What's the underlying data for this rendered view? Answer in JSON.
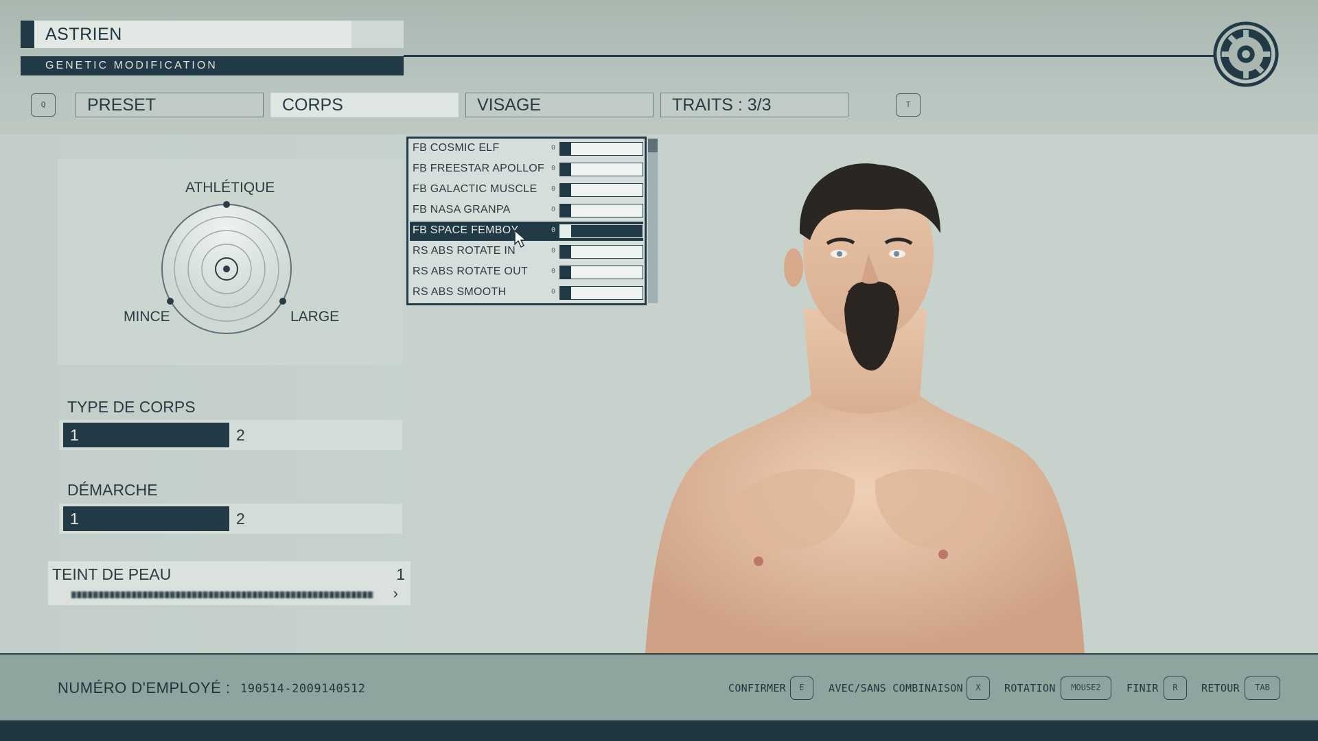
{
  "header": {
    "character_name": "ASTRIEN",
    "subtitle": "GENETIC MODIFICATION",
    "logo_icon": "constellation-gear-icon"
  },
  "tabs": {
    "prev_key": "Q",
    "next_key": "T",
    "items": [
      {
        "label": "PRESET",
        "active": false
      },
      {
        "label": "CORPS",
        "active": true
      },
      {
        "label": "VISAGE",
        "active": false
      },
      {
        "label": "TRAITS : 3/3",
        "active": false
      }
    ]
  },
  "body_shape": {
    "top_label": "ATHLÉTIQUE",
    "left_label": "MINCE",
    "right_label": "LARGE"
  },
  "body_type": {
    "label": "TYPE DE CORPS",
    "options": [
      "1",
      "2"
    ],
    "selected": "1"
  },
  "gait": {
    "label": "DÉMARCHE",
    "options": [
      "1",
      "2"
    ],
    "selected": "1"
  },
  "skin_tone": {
    "label": "TEINT DE PEAU",
    "value": "1"
  },
  "morphs": {
    "items": [
      {
        "name": "FB COSMIC ELF",
        "value": "0",
        "selected": false
      },
      {
        "name": "FB FREESTAR APOLLOF",
        "value": "0",
        "selected": false
      },
      {
        "name": "FB GALACTIC MUSCLE",
        "value": "0",
        "selected": false
      },
      {
        "name": "FB NASA GRANPA",
        "value": "0",
        "selected": false
      },
      {
        "name": "FB SPACE FEMBOY",
        "value": "0",
        "selected": true
      },
      {
        "name": "RS ABS ROTATE IN",
        "value": "0",
        "selected": false
      },
      {
        "name": "RS ABS ROTATE OUT",
        "value": "0",
        "selected": false
      },
      {
        "name": "RS ABS SMOOTH",
        "value": "0",
        "selected": false
      }
    ]
  },
  "footer": {
    "employee_label": "NUMÉRO D'EMPLOYÉ :",
    "employee_number": "190514-2009140512",
    "actions": [
      {
        "label": "CONFIRMER",
        "key": "E"
      },
      {
        "label": "AVEC/SANS COMBINAISON",
        "key": "X"
      },
      {
        "label": "ROTATION",
        "key": "MOUSE2"
      },
      {
        "label": "FINIR",
        "key": "R"
      },
      {
        "label": "RETOUR",
        "key": "TAB"
      }
    ]
  },
  "colors": {
    "accent_dark": "#223a46",
    "panel_light": "#d4dcd8",
    "background": "#c7d2cc"
  }
}
